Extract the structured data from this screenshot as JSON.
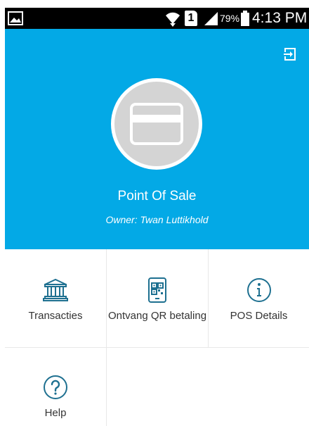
{
  "status_bar": {
    "icons": [
      "gallery-icon",
      "wifi-icon",
      "sim-icon",
      "signal-icon",
      "battery-icon"
    ],
    "sim_slot": "1",
    "battery_percent": "79%",
    "time": "4:13 PM"
  },
  "header": {
    "background": "#03a9e6",
    "logout_icon": "logout-icon",
    "avatar_icon": "credit-card-icon",
    "title": "Point Of Sale",
    "owner": "Owner: Twan Luttikhold"
  },
  "menu": {
    "accent": "#1e7090",
    "items": [
      {
        "icon": "bank-icon",
        "label": "Transacties"
      },
      {
        "icon": "qr-code-icon",
        "label": "Ontvang QR betaling"
      },
      {
        "icon": "info-icon",
        "label": "POS Details"
      },
      {
        "icon": "help-icon",
        "label": "Help"
      }
    ]
  }
}
